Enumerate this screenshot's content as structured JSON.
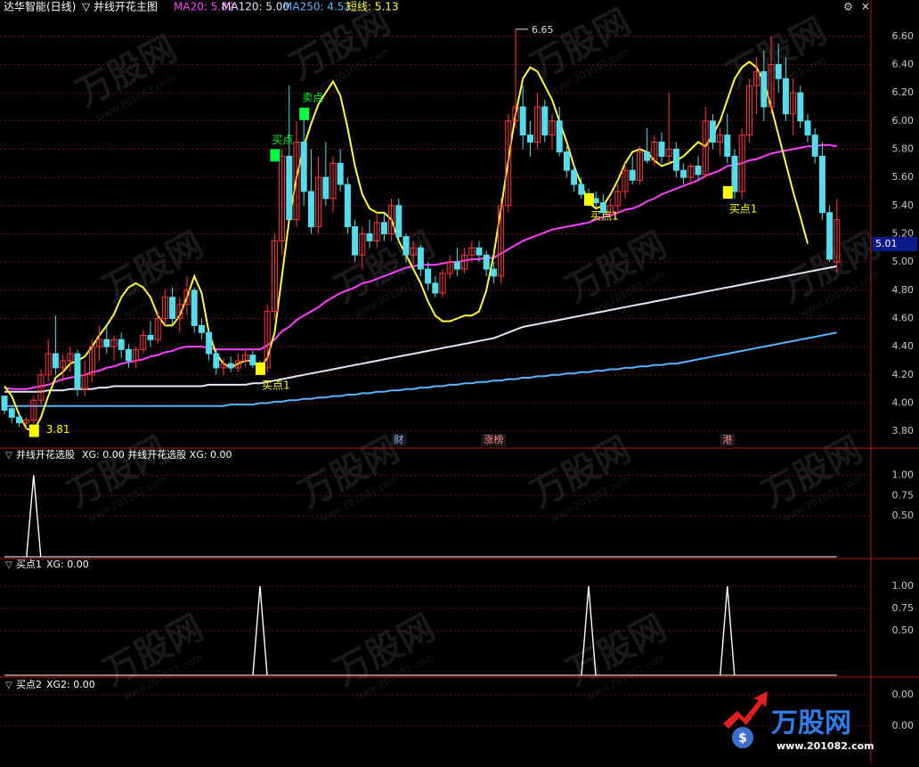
{
  "colors": {
    "bg": "#000000",
    "grid": "#7a1010",
    "separator": "#b01818",
    "axis_text": "#c8c8c8",
    "up": "#ff3b3b",
    "down": "#54dcec",
    "ma20": "#ff40ff",
    "ma120": "#e6e6fa",
    "ma250": "#5ab4ff",
    "short": "#ffff3c",
    "buy": "#ffff00",
    "sell": "#00ff3c",
    "signal": "#ffffff",
    "price_box": "#0b1a8a"
  },
  "main": {
    "title": "达华智能(日线)",
    "formula": "并线开花主图",
    "legend": [
      {
        "text": "MA20: 5.82",
        "color": "#ff40ff"
      },
      {
        "text": "MA120: 5.00",
        "color": "#e6e6fa"
      },
      {
        "text": "MA250: 4.52",
        "color": "#5ab4ff"
      },
      {
        "text": "短线: 5.13",
        "color": "#ffff3c"
      }
    ],
    "current_price": "5.01",
    "high_label": "6.65",
    "low_label": "3.81",
    "buy_labels": [
      "买点1",
      "买点1",
      "买点1",
      "买点"
    ],
    "sell_label": "卖点",
    "event_tags": [
      "财",
      "涨榜",
      "港"
    ]
  },
  "panels": [
    {
      "title": "并线开花选股",
      "value_text": "XG: 0.00  并线开花选股  XG: 0.00"
    },
    {
      "title": "买点1",
      "value_text": "XG: 0.00"
    },
    {
      "title": "买点2",
      "value_text": "XG2: 0.00"
    }
  ],
  "watermark": {
    "brand": "万股网",
    "url": "www.201082.com"
  },
  "chart_data": [
    {
      "type": "candlestick",
      "ylim": [
        3.7,
        6.75
      ],
      "yticks": [
        3.8,
        4.0,
        4.2,
        4.4,
        4.6,
        4.8,
        5.0,
        5.2,
        5.4,
        5.6,
        5.8,
        6.0,
        6.2,
        6.4,
        6.6
      ],
      "ohlc": [
        [
          4.05,
          4.05,
          3.92,
          3.95
        ],
        [
          3.96,
          3.98,
          3.86,
          3.9
        ],
        [
          3.9,
          3.94,
          3.83,
          3.86
        ],
        [
          3.86,
          3.9,
          3.81,
          3.88
        ],
        [
          3.88,
          4.05,
          3.85,
          4.02
        ],
        [
          4.02,
          4.24,
          3.98,
          4.2
        ],
        [
          4.2,
          4.45,
          4.15,
          4.35
        ],
        [
          4.35,
          4.62,
          4.2,
          4.25
        ],
        [
          4.25,
          4.35,
          4.15,
          4.3
        ],
        [
          4.3,
          4.4,
          4.22,
          4.35
        ],
        [
          4.35,
          4.38,
          4.05,
          4.1
        ],
        [
          4.1,
          4.3,
          4.05,
          4.2
        ],
        [
          4.2,
          4.45,
          4.15,
          4.4
        ],
        [
          4.4,
          4.55,
          4.3,
          4.45
        ],
        [
          4.45,
          4.55,
          4.35,
          4.4
        ],
        [
          4.4,
          4.48,
          4.3,
          4.45
        ],
        [
          4.45,
          4.5,
          4.32,
          4.38
        ],
        [
          4.38,
          4.42,
          4.25,
          4.3
        ],
        [
          4.3,
          4.4,
          4.25,
          4.38
        ],
        [
          4.38,
          4.52,
          4.35,
          4.48
        ],
        [
          4.48,
          4.58,
          4.4,
          4.45
        ],
        [
          4.45,
          4.65,
          4.42,
          4.6
        ],
        [
          4.6,
          4.8,
          4.55,
          4.75
        ],
        [
          4.75,
          4.82,
          4.55,
          4.6
        ],
        [
          4.6,
          4.75,
          4.5,
          4.7
        ],
        [
          4.7,
          4.9,
          4.62,
          4.8
        ],
        [
          4.8,
          4.82,
          4.5,
          4.55
        ],
        [
          4.55,
          4.6,
          4.45,
          4.5
        ],
        [
          4.5,
          4.52,
          4.3,
          4.35
        ],
        [
          4.35,
          4.38,
          4.2,
          4.25
        ],
        [
          4.25,
          4.32,
          4.2,
          4.28
        ],
        [
          4.28,
          4.33,
          4.22,
          4.25
        ],
        [
          4.25,
          4.35,
          4.22,
          4.3
        ],
        [
          4.3,
          4.38,
          4.26,
          4.34
        ],
        [
          4.34,
          4.37,
          4.25,
          4.27
        ],
        [
          4.27,
          4.3,
          4.22,
          4.25
        ],
        [
          4.25,
          4.7,
          4.22,
          4.65
        ],
        [
          4.65,
          5.2,
          4.6,
          5.15
        ],
        [
          5.15,
          5.8,
          5.05,
          5.75
        ],
        [
          5.75,
          6.25,
          5.3,
          5.3
        ],
        [
          5.3,
          6.0,
          5.25,
          5.85
        ],
        [
          5.85,
          6.05,
          5.4,
          5.5
        ],
        [
          5.5,
          5.8,
          5.2,
          5.25
        ],
        [
          5.25,
          5.75,
          5.2,
          5.6
        ],
        [
          5.6,
          5.85,
          5.4,
          5.45
        ],
        [
          5.45,
          5.75,
          5.35,
          5.7
        ],
        [
          5.7,
          5.8,
          5.5,
          5.55
        ],
        [
          5.55,
          5.6,
          5.2,
          5.25
        ],
        [
          5.25,
          5.3,
          5.0,
          5.05
        ],
        [
          5.05,
          5.25,
          4.95,
          5.2
        ],
        [
          5.2,
          5.3,
          5.1,
          5.15
        ],
        [
          5.15,
          5.35,
          5.1,
          5.28
        ],
        [
          5.28,
          5.35,
          5.15,
          5.2
        ],
        [
          5.2,
          5.45,
          5.15,
          5.4
        ],
        [
          5.4,
          5.45,
          5.15,
          5.18
        ],
        [
          5.18,
          5.2,
          5.0,
          5.05
        ],
        [
          5.05,
          5.15,
          4.98,
          5.1
        ],
        [
          5.1,
          5.12,
          4.9,
          4.95
        ],
        [
          4.95,
          5.0,
          4.8,
          4.85
        ],
        [
          4.85,
          4.9,
          4.75,
          4.78
        ],
        [
          4.78,
          4.95,
          4.75,
          4.92
        ],
        [
          4.92,
          5.05,
          4.88,
          5.0
        ],
        [
          5.0,
          5.1,
          4.9,
          4.95
        ],
        [
          4.95,
          5.1,
          4.92,
          5.05
        ],
        [
          5.05,
          5.15,
          5.0,
          5.1
        ],
        [
          5.1,
          5.15,
          5.0,
          5.05
        ],
        [
          5.05,
          5.08,
          4.9,
          4.95
        ],
        [
          4.95,
          5.0,
          4.85,
          4.9
        ],
        [
          4.9,
          5.45,
          4.85,
          5.4
        ],
        [
          5.4,
          6.05,
          5.35,
          6.0
        ],
        [
          6.0,
          6.65,
          5.95,
          6.1
        ],
        [
          6.1,
          6.25,
          5.8,
          5.9
        ],
        [
          5.9,
          6.0,
          5.75,
          5.85
        ],
        [
          5.85,
          6.2,
          5.8,
          6.1
        ],
        [
          6.1,
          6.15,
          5.85,
          5.9
        ],
        [
          5.9,
          6.05,
          5.8,
          6.0
        ],
        [
          6.0,
          6.1,
          5.75,
          5.78
        ],
        [
          5.78,
          5.82,
          5.6,
          5.65
        ],
        [
          5.65,
          5.7,
          5.5,
          5.55
        ],
        [
          5.55,
          5.6,
          5.45,
          5.48
        ],
        [
          5.48,
          5.52,
          5.4,
          5.45
        ],
        [
          5.45,
          5.5,
          5.38,
          5.42
        ],
        [
          5.42,
          5.48,
          5.3,
          5.35
        ],
        [
          5.35,
          5.45,
          5.3,
          5.4
        ],
        [
          5.4,
          5.55,
          5.35,
          5.5
        ],
        [
          5.5,
          5.7,
          5.45,
          5.65
        ],
        [
          5.65,
          5.75,
          5.55,
          5.58
        ],
        [
          5.58,
          5.82,
          5.55,
          5.78
        ],
        [
          5.78,
          5.95,
          5.7,
          5.72
        ],
        [
          5.72,
          5.9,
          5.68,
          5.85
        ],
        [
          5.85,
          5.92,
          5.7,
          5.75
        ],
        [
          5.75,
          6.2,
          5.7,
          5.8
        ],
        [
          5.8,
          5.85,
          5.6,
          5.65
        ],
        [
          5.65,
          5.7,
          5.55,
          5.6
        ],
        [
          5.6,
          5.7,
          5.55,
          5.68
        ],
        [
          5.68,
          5.75,
          5.58,
          5.62
        ],
        [
          5.62,
          6.1,
          5.6,
          6.0
        ],
        [
          6.0,
          6.05,
          5.8,
          5.85
        ],
        [
          5.85,
          5.95,
          5.75,
          5.9
        ],
        [
          5.9,
          6.05,
          5.7,
          5.75
        ],
        [
          5.75,
          5.8,
          5.45,
          5.5
        ],
        [
          5.5,
          5.95,
          5.45,
          5.9
        ],
        [
          5.9,
          6.3,
          5.85,
          6.25
        ],
        [
          6.25,
          6.45,
          6.05,
          6.35
        ],
        [
          6.35,
          6.5,
          6.0,
          6.1
        ],
        [
          6.1,
          6.6,
          6.05,
          6.4
        ],
        [
          6.4,
          6.55,
          6.2,
          6.3
        ],
        [
          6.3,
          6.45,
          6.0,
          6.05
        ],
        [
          6.05,
          6.3,
          5.9,
          6.2
        ],
        [
          6.2,
          6.25,
          5.95,
          6.0
        ],
        [
          6.0,
          6.05,
          5.85,
          5.9
        ],
        [
          5.9,
          5.95,
          5.7,
          5.75
        ],
        [
          5.75,
          5.85,
          5.3,
          5.35
        ],
        [
          5.35,
          5.4,
          5.0,
          5.02
        ],
        [
          5.0,
          5.45,
          4.92,
          5.3
        ]
      ],
      "ma20": [
        4.11,
        4.1,
        4.1,
        4.1,
        4.11,
        4.12,
        4.13,
        4.15,
        4.17,
        4.18,
        4.19,
        4.2,
        4.22,
        4.23,
        4.25,
        4.26,
        4.28,
        4.29,
        4.3,
        4.31,
        4.33,
        4.34,
        4.36,
        4.37,
        4.39,
        4.4,
        4.4,
        4.4,
        4.39,
        4.38,
        4.38,
        4.38,
        4.38,
        4.38,
        4.38,
        4.38,
        4.41,
        4.45,
        4.51,
        4.54,
        4.59,
        4.62,
        4.65,
        4.68,
        4.72,
        4.75,
        4.78,
        4.8,
        4.82,
        4.85,
        4.86,
        4.88,
        4.9,
        4.92,
        4.94,
        4.96,
        4.97,
        4.98,
        4.98,
        4.98,
        4.99,
        5.0,
        5.0,
        5.01,
        5.02,
        5.02,
        5.03,
        5.03,
        5.06,
        5.09,
        5.12,
        5.15,
        5.17,
        5.19,
        5.21,
        5.23,
        5.24,
        5.25,
        5.26,
        5.27,
        5.28,
        5.3,
        5.32,
        5.33,
        5.35,
        5.37,
        5.38,
        5.4,
        5.43,
        5.45,
        5.48,
        5.5,
        5.52,
        5.54,
        5.56,
        5.58,
        5.61,
        5.63,
        5.65,
        5.68,
        5.69,
        5.7,
        5.72,
        5.73,
        5.75,
        5.77,
        5.78,
        5.79,
        5.8,
        5.81,
        5.82,
        5.82,
        5.83,
        5.83,
        5.82
      ],
      "ma120": [
        4.08,
        4.08,
        4.08,
        4.08,
        4.08,
        4.08,
        4.09,
        4.09,
        4.09,
        4.1,
        4.1,
        4.1,
        4.1,
        4.11,
        4.11,
        4.12,
        4.12,
        4.12,
        4.12,
        4.12,
        4.12,
        4.12,
        4.12,
        4.12,
        4.12,
        4.12,
        4.12,
        4.12,
        4.13,
        4.13,
        4.13,
        4.13,
        4.13,
        4.13,
        4.14,
        4.14,
        4.15,
        4.16,
        4.17,
        4.18,
        4.19,
        4.2,
        4.21,
        4.22,
        4.23,
        4.24,
        4.25,
        4.26,
        4.27,
        4.28,
        4.29,
        4.3,
        4.31,
        4.32,
        4.33,
        4.34,
        4.35,
        4.36,
        4.37,
        4.38,
        4.39,
        4.4,
        4.41,
        4.42,
        4.43,
        4.44,
        4.45,
        4.46,
        4.48,
        4.5,
        4.52,
        4.54,
        4.55,
        4.56,
        4.57,
        4.58,
        4.59,
        4.6,
        4.61,
        4.62,
        4.63,
        4.64,
        4.65,
        4.66,
        4.67,
        4.68,
        4.69,
        4.7,
        4.71,
        4.72,
        4.73,
        4.74,
        4.75,
        4.76,
        4.77,
        4.78,
        4.79,
        4.8,
        4.81,
        4.82,
        4.83,
        4.84,
        4.85,
        4.86,
        4.87,
        4.88,
        4.89,
        4.9,
        4.91,
        4.92,
        4.93,
        4.94,
        4.95,
        4.96,
        4.97
      ],
      "ma250": [
        3.98,
        3.98,
        3.98,
        3.98,
        3.98,
        3.98,
        3.98,
        3.98,
        3.98,
        3.98,
        3.98,
        3.98,
        3.98,
        3.98,
        3.98,
        3.98,
        3.98,
        3.98,
        3.98,
        3.98,
        3.98,
        3.98,
        3.98,
        3.98,
        3.98,
        3.98,
        3.98,
        3.98,
        3.98,
        3.98,
        3.98,
        3.99,
        3.99,
        3.99,
        3.99,
        4.0,
        4.0,
        4.01,
        4.01,
        4.02,
        4.02,
        4.03,
        4.03,
        4.04,
        4.04,
        4.05,
        4.05,
        4.06,
        4.06,
        4.07,
        4.07,
        4.08,
        4.08,
        4.09,
        4.09,
        4.1,
        4.1,
        4.11,
        4.11,
        4.12,
        4.12,
        4.13,
        4.13,
        4.14,
        4.14,
        4.15,
        4.15,
        4.16,
        4.16,
        4.17,
        4.17,
        4.18,
        4.18,
        4.19,
        4.19,
        4.2,
        4.2,
        4.21,
        4.21,
        4.22,
        4.22,
        4.23,
        4.23,
        4.24,
        4.24,
        4.25,
        4.25,
        4.26,
        4.26,
        4.27,
        4.27,
        4.28,
        4.28,
        4.29,
        4.3,
        4.31,
        4.32,
        4.33,
        4.34,
        4.35,
        4.36,
        4.37,
        4.38,
        4.39,
        4.4,
        4.41,
        4.42,
        4.43,
        4.44,
        4.45,
        4.46,
        4.47,
        4.48,
        4.49,
        4.5
      ],
      "short_line": [
        4.12,
        4.05,
        3.92,
        3.82,
        3.8,
        3.9,
        4.05,
        4.18,
        4.22,
        4.28,
        4.3,
        4.33,
        4.4,
        4.48,
        4.55,
        4.63,
        4.75,
        4.82,
        4.85,
        4.82,
        4.75,
        4.62,
        4.55,
        4.55,
        4.62,
        4.75,
        4.9,
        4.78,
        4.5,
        4.35,
        4.28,
        4.25,
        4.28,
        4.3,
        4.3,
        4.25,
        4.32,
        4.5,
        4.9,
        5.3,
        5.6,
        5.82,
        5.98,
        6.12,
        6.2,
        6.28,
        6.18,
        5.95,
        5.68,
        5.48,
        5.38,
        5.35,
        5.35,
        5.3,
        5.15,
        5.05,
        4.95,
        4.85,
        4.72,
        4.62,
        4.58,
        4.58,
        4.6,
        4.62,
        4.62,
        4.65,
        4.8,
        5.05,
        5.38,
        5.72,
        6.05,
        6.3,
        6.38,
        6.35,
        6.25,
        6.15,
        6.0,
        5.85,
        5.68,
        5.55,
        5.42,
        5.38,
        5.4,
        5.48,
        5.58,
        5.7,
        5.78,
        5.8,
        5.78,
        5.72,
        5.68,
        5.7,
        5.72,
        5.75,
        5.8,
        5.85,
        5.82,
        5.9,
        6.0,
        6.15,
        6.3,
        6.38,
        6.42,
        6.38,
        6.28,
        6.1,
        5.9,
        5.7,
        5.5,
        5.32,
        5.13
      ],
      "buy_markers": [
        {
          "index": 4,
          "value": 3.81
        },
        {
          "index": 35,
          "value": 4.25
        },
        {
          "index": 80,
          "value": 5.45
        },
        {
          "index": 99,
          "value": 5.5
        },
        {
          "index": 37,
          "value": 5.75
        }
      ],
      "sell_markers": [
        {
          "index": 41,
          "value": 6.05
        }
      ],
      "event_tags": [
        {
          "index": 54,
          "text": "财"
        },
        {
          "index": 67,
          "text": "涨榜"
        },
        {
          "index": 99,
          "text": "港"
        }
      ]
    },
    {
      "type": "line",
      "name": "XG",
      "yticks": [
        0.5,
        0.75,
        1.0
      ],
      "ylim": [
        0,
        1.2
      ],
      "spikes": [
        4
      ],
      "last": 0.0
    },
    {
      "type": "line",
      "name": "XG",
      "yticks": [
        0.5,
        0.75,
        1.0
      ],
      "ylim": [
        0,
        1.2
      ],
      "spikes": [
        35,
        80,
        99
      ],
      "last": 0.0
    },
    {
      "type": "line",
      "name": "XG2",
      "yticks": [
        0.0,
        0.0
      ],
      "ylim": [
        -1,
        1
      ],
      "spikes": [],
      "last": 0.0
    }
  ]
}
